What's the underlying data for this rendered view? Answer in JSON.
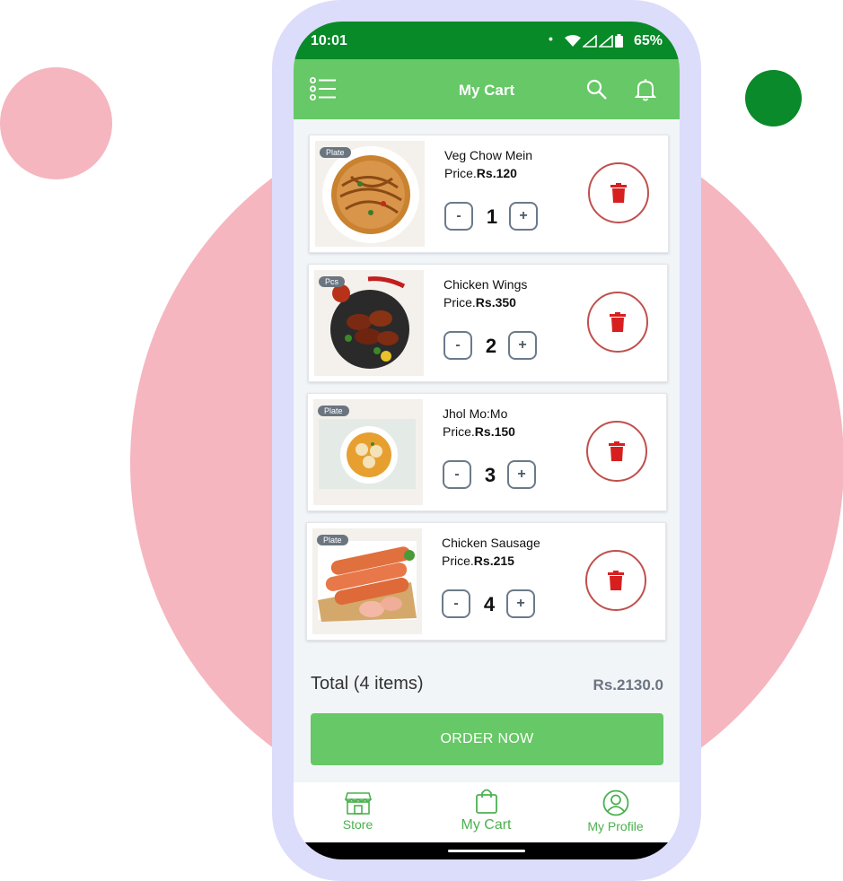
{
  "status_bar": {
    "time": "10:01",
    "battery": "65%"
  },
  "app_bar": {
    "title": "My Cart"
  },
  "cart_items": [
    {
      "unit": "Plate",
      "name": "Veg Chow Mein",
      "price_prefix": "Price.",
      "price": "Rs.120",
      "qty": "1"
    },
    {
      "unit": "Pcs",
      "name": "Chicken Wings",
      "price_prefix": "Price.",
      "price": "Rs.350",
      "qty": "2"
    },
    {
      "unit": "Plate",
      "name": "Jhol Mo:Mo",
      "price_prefix": "Price.",
      "price": "Rs.150",
      "qty": "3"
    },
    {
      "unit": "Plate",
      "name": "Chicken Sausage",
      "price_prefix": "Price.",
      "price": "Rs.215",
      "qty": "4"
    }
  ],
  "qty_controls": {
    "minus": "-",
    "plus": "+"
  },
  "summary": {
    "total_label": "Total (4 items)",
    "total_value": "Rs.2130.0"
  },
  "order_button": {
    "label": "ORDER NOW"
  },
  "bottom_nav": {
    "items": [
      {
        "label": "Store",
        "icon": "store-icon"
      },
      {
        "label": "My Cart",
        "icon": "shopping-bag-icon"
      },
      {
        "label": "My Profile",
        "icon": "profile-icon"
      }
    ]
  },
  "colors": {
    "status_bar": "#078a27",
    "accent": "#66c866",
    "delete": "#c0504d",
    "delete_icon": "#d81f1f",
    "bg_pink": "#f5b6bf"
  }
}
